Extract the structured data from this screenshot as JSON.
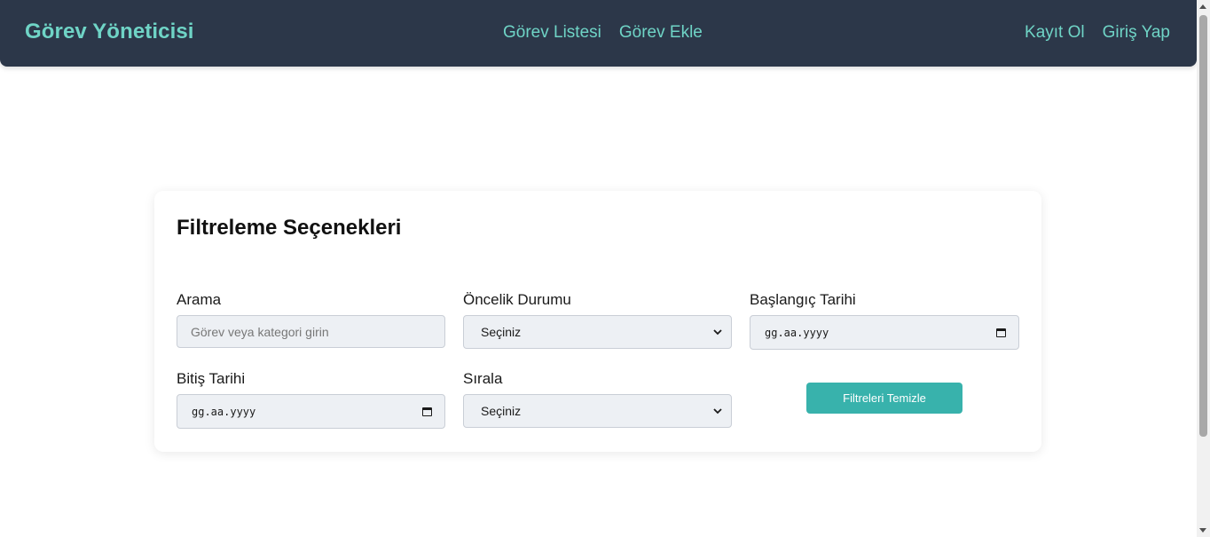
{
  "header": {
    "brand": "Görev Yöneticisi",
    "nav": [
      "Görev Listesi",
      "Görev Ekle"
    ],
    "auth": [
      "Kayıt Ol",
      "Giriş Yap"
    ]
  },
  "filters": {
    "title": "Filtreleme Seçenekleri",
    "search": {
      "label": "Arama",
      "placeholder": "Görev veya kategori girin"
    },
    "priority": {
      "label": "Öncelik Durumu",
      "selected": "Seçiniz"
    },
    "start_date": {
      "label": "Başlangıç Tarihi",
      "value": "gg.aa.yyyy"
    },
    "end_date": {
      "label": "Bitiş Tarihi",
      "value": "gg.aa.yyyy"
    },
    "sort": {
      "label": "Sırala",
      "selected": "Seçiniz"
    },
    "clear_button": "Filtreleri Temizle"
  },
  "colors": {
    "navbar_bg": "#2c3749",
    "accent_text": "#6fd4c6",
    "button_bg": "#38b2ac"
  }
}
